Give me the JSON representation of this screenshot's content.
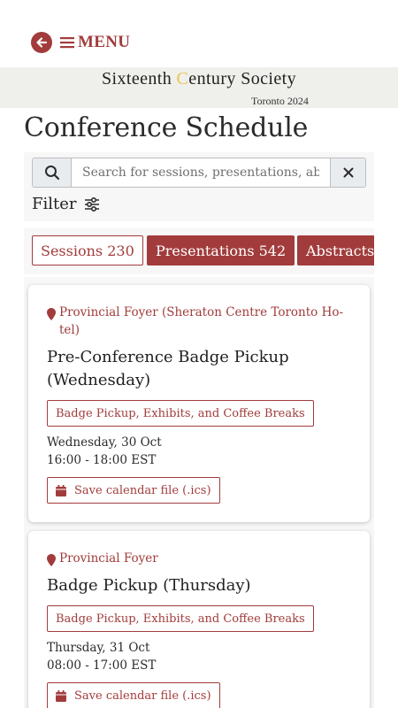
{
  "nav": {
    "back_icon": "arrow-left-circle-icon",
    "menu_icon": "hamburger-icon",
    "menu_label": "MENU"
  },
  "banner": {
    "title_part1": "Sixteenth ",
    "title_highlight": "C",
    "title_part2": "entury Society",
    "subtitle": "Toronto 2024"
  },
  "page_title": "Conference Schedule",
  "search": {
    "placeholder": "Search for sessions, presentations, abstracts",
    "value": ""
  },
  "filter": {
    "label": "Filter"
  },
  "tabs": [
    {
      "label": "Sessions 230",
      "active": false
    },
    {
      "label": "Presentations 542",
      "active": true
    },
    {
      "label": "Abstracts",
      "active": true
    }
  ],
  "events": [
    {
      "location_line1": "Provincial Foyer (Sheraton Centre Toronto Ho-",
      "location_line2": "tel)",
      "title_line1": "Pre-Conference Badge Pickup",
      "title_line2": "(Wednesday)",
      "tag": "Badge Pickup, Exhibits, and Coffee Breaks",
      "date": "Wednesday, 30 Oct",
      "time": "16:00 - 18:00 EST",
      "ics_label": "Save calendar file (.ics)"
    },
    {
      "location_line1": "Provincial Foyer",
      "title_line1": "Badge Pickup (Thursday)",
      "tag": "Badge Pickup, Exhibits, and Coffee Breaks",
      "date": "Thursday, 31 Oct",
      "time": "08:00 - 17:00 EST",
      "ics_label": "Save calendar file (.ics)"
    }
  ],
  "colors": {
    "accent": "#a23c3c",
    "banner_bg": "#efefec",
    "panel_bg": "#f7f7f7",
    "banner_highlight": "#e8c84a"
  }
}
